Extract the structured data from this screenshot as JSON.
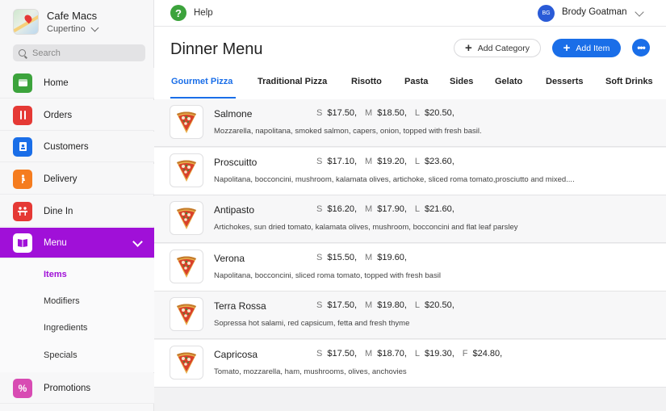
{
  "store": {
    "name": "Cafe Macs",
    "location": "Cupertino"
  },
  "search": {
    "placeholder": "Search"
  },
  "nav": [
    {
      "label": "Home",
      "icon": "home-icon",
      "color": "#3ca33c"
    },
    {
      "label": "Orders",
      "icon": "fork-knife-icon",
      "color": "#e53935"
    },
    {
      "label": "Customers",
      "icon": "contact-card-icon",
      "color": "#1a6ee8"
    },
    {
      "label": "Delivery",
      "icon": "delivery-icon",
      "color": "#f57c1f"
    },
    {
      "label": "Dine In",
      "icon": "dine-in-icon",
      "color": "#e53935"
    },
    {
      "label": "Menu",
      "icon": "book-icon",
      "color": "#a010d8"
    },
    {
      "label": "Promotions",
      "icon": "percent-icon",
      "color": "#d84bb3"
    }
  ],
  "menu_sub": [
    "Items",
    "Modifiers",
    "Ingredients",
    "Specials"
  ],
  "topbar": {
    "help": "Help",
    "user_initials": "BG",
    "user_name": "Brody Goatman"
  },
  "header": {
    "title": "Dinner Menu",
    "add_category": "Add Category",
    "add_item": "Add Item",
    "more": "•••"
  },
  "tabs": [
    "Gourmet Pizza",
    "Traditional Pizza",
    "Risotto",
    "Pasta",
    "Sides",
    "Gelato",
    "Desserts",
    "Soft Drinks"
  ],
  "items": [
    {
      "name": "Salmone",
      "prices": [
        [
          "S",
          "$17.50,"
        ],
        [
          "M",
          "$18.50,"
        ],
        [
          "L",
          "$20.50,"
        ]
      ],
      "description": "Mozzarella, napolitana, smoked salmon, capers, onion, topped with fresh basil."
    },
    {
      "name": "Proscuitto",
      "prices": [
        [
          "S",
          "$17.10,"
        ],
        [
          "M",
          "$19.20,"
        ],
        [
          "L",
          "$23.60,"
        ]
      ],
      "description": "Napolitana, bocconcini, mushroom, kalamata olives, artichoke, sliced roma tomato,prosciutto and mixed...."
    },
    {
      "name": "Antipasto",
      "prices": [
        [
          "S",
          "$16.20,"
        ],
        [
          "M",
          "$17.90,"
        ],
        [
          "L",
          "$21.60,"
        ]
      ],
      "description": "Artichokes, sun dried tomato, kalamata olives, mushroom, bocconcini and flat leaf parsley"
    },
    {
      "name": "Verona",
      "prices": [
        [
          "S",
          "$15.50,"
        ],
        [
          "M",
          "$19.60,"
        ]
      ],
      "description": "Napolitana, bocconcini, sliced roma tomato, topped with fresh basil"
    },
    {
      "name": "Terra Rossa",
      "prices": [
        [
          "S",
          "$17.50,"
        ],
        [
          "M",
          "$19.80,"
        ],
        [
          "L",
          "$20.50,"
        ]
      ],
      "description": "Sopressa hot salami, red capsicum, fetta and fresh thyme"
    },
    {
      "name": "Capricosa",
      "prices": [
        [
          "S",
          "$17.50,"
        ],
        [
          "M",
          "$18.70,"
        ],
        [
          "L",
          "$19.30,"
        ],
        [
          "F",
          "$24.80,"
        ]
      ],
      "description": "Tomato, mozzarella, ham, mushrooms, olives, anchovies"
    }
  ]
}
